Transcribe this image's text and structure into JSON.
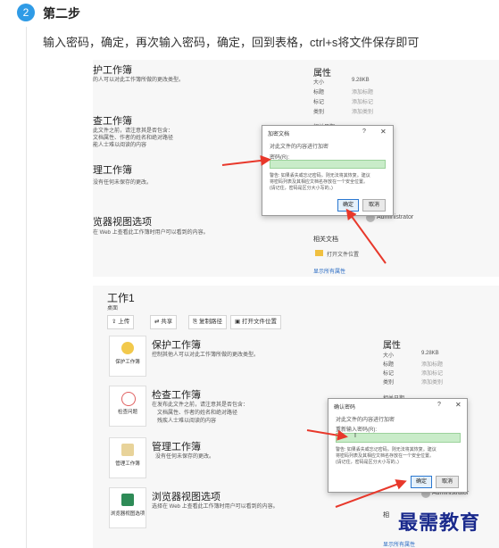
{
  "step": {
    "number": "2",
    "title": "第二步",
    "description": "输入密码，确定，再次输入密码，确定，回到表格，ctrl+s将文件保存即可"
  },
  "screenshot1": {
    "protect_title": "护工作簿",
    "protect_desc": "的人可以对此工作簿所做的更改类型。",
    "inspect_title": "查工作簿",
    "inspect_desc": [
      "此文件之前，请注意其是否包含：",
      "文档属性、作者的姓名和绝对路径",
      "能人士难以阅读的内容"
    ],
    "manage_title": "理工作簿",
    "manage_desc": "没有任何未保存的更改。",
    "browser_title": "览器视图选项",
    "browser_desc": "在 Web 上查看此工作簿时用户可以看到的内容。",
    "properties_title": "属性",
    "properties": [
      {
        "key": "大小",
        "value": "9.28KB"
      },
      {
        "key": "标题",
        "value": "添加标题"
      },
      {
        "key": "标记",
        "value": "添加标记"
      },
      {
        "key": "类别",
        "value": "添加类别"
      }
    ],
    "people_partial": "相关日期",
    "author": "Administrator",
    "related_docs": "相关文档",
    "open_location": "打开文件位置",
    "show_all": "显示所有属性",
    "dialog": {
      "title": "加密文档",
      "question": "?",
      "close": "✕",
      "subtitle": "对此文件的内容进行加密",
      "label": "密码(R):",
      "warning": [
        "警告: 如果丢失或忘记密码，则无法将其恢复。建议",
        "将密码列表及其相应文档名存放在一个安全位置。",
        "(请记住，密码是区分大小写的。)"
      ],
      "ok": "确定",
      "cancel": "取消"
    }
  },
  "screenshot2": {
    "workbook_title": "工作1",
    "location": "桌面",
    "toolbar": [
      "上传",
      "共享",
      "复制路径",
      "打开文件位置"
    ],
    "protect_tile": "保护工作簿",
    "protect_title": "保护工作簿",
    "protect_desc": "控制其他人可以对此工作簿所做的更改类型。",
    "inspect_tile": "检查问题",
    "inspect_title": "检查工作簿",
    "inspect_desc": [
      "在发布此文件之前，请注意其是否包含：",
      "文档属性、作者的姓名和绝对路径",
      "残疾人士难以阅读的内容"
    ],
    "manage_tile": "管理工作簿",
    "manage_title": "管理工作簿",
    "manage_desc": "没有任何未保存的更改。",
    "browser_tile": "浏览器视图选项",
    "browser_title": "浏览器视图选项",
    "browser_desc": "选择在 Web 上查看此工作簿时用户可以看到的内容。",
    "properties_title": "属性",
    "properties": [
      {
        "key": "大小",
        "value": "9.28KB"
      },
      {
        "key": "标题",
        "value": "添加标题"
      },
      {
        "key": "标记",
        "value": "添加标记"
      },
      {
        "key": "类别",
        "value": "添加类别"
      }
    ],
    "people_partial": "相关日期",
    "author": "Administrator",
    "related_partial": "相",
    "show_all": "显示所有属性",
    "dialog": {
      "title": "确认密码",
      "question": "?",
      "close": "✕",
      "subtitle": "对此文件的内容进行加密",
      "label": "重新输入密码(R):",
      "cursor": "I",
      "warning": [
        "警告: 如果丢失或忘记密码，则无法将其恢复。建议",
        "将密码列表及其相应文档名存放在一个安全位置。",
        "(请记住，密码是区分大小写的。)"
      ],
      "ok": "确定",
      "cancel": "取消"
    }
  },
  "watermark": "最需教育",
  "colors": {
    "accent": "#2f9be6",
    "arrow": "#e8382b",
    "field": "#c9ecc9",
    "watermark": "#1a2a8c"
  }
}
